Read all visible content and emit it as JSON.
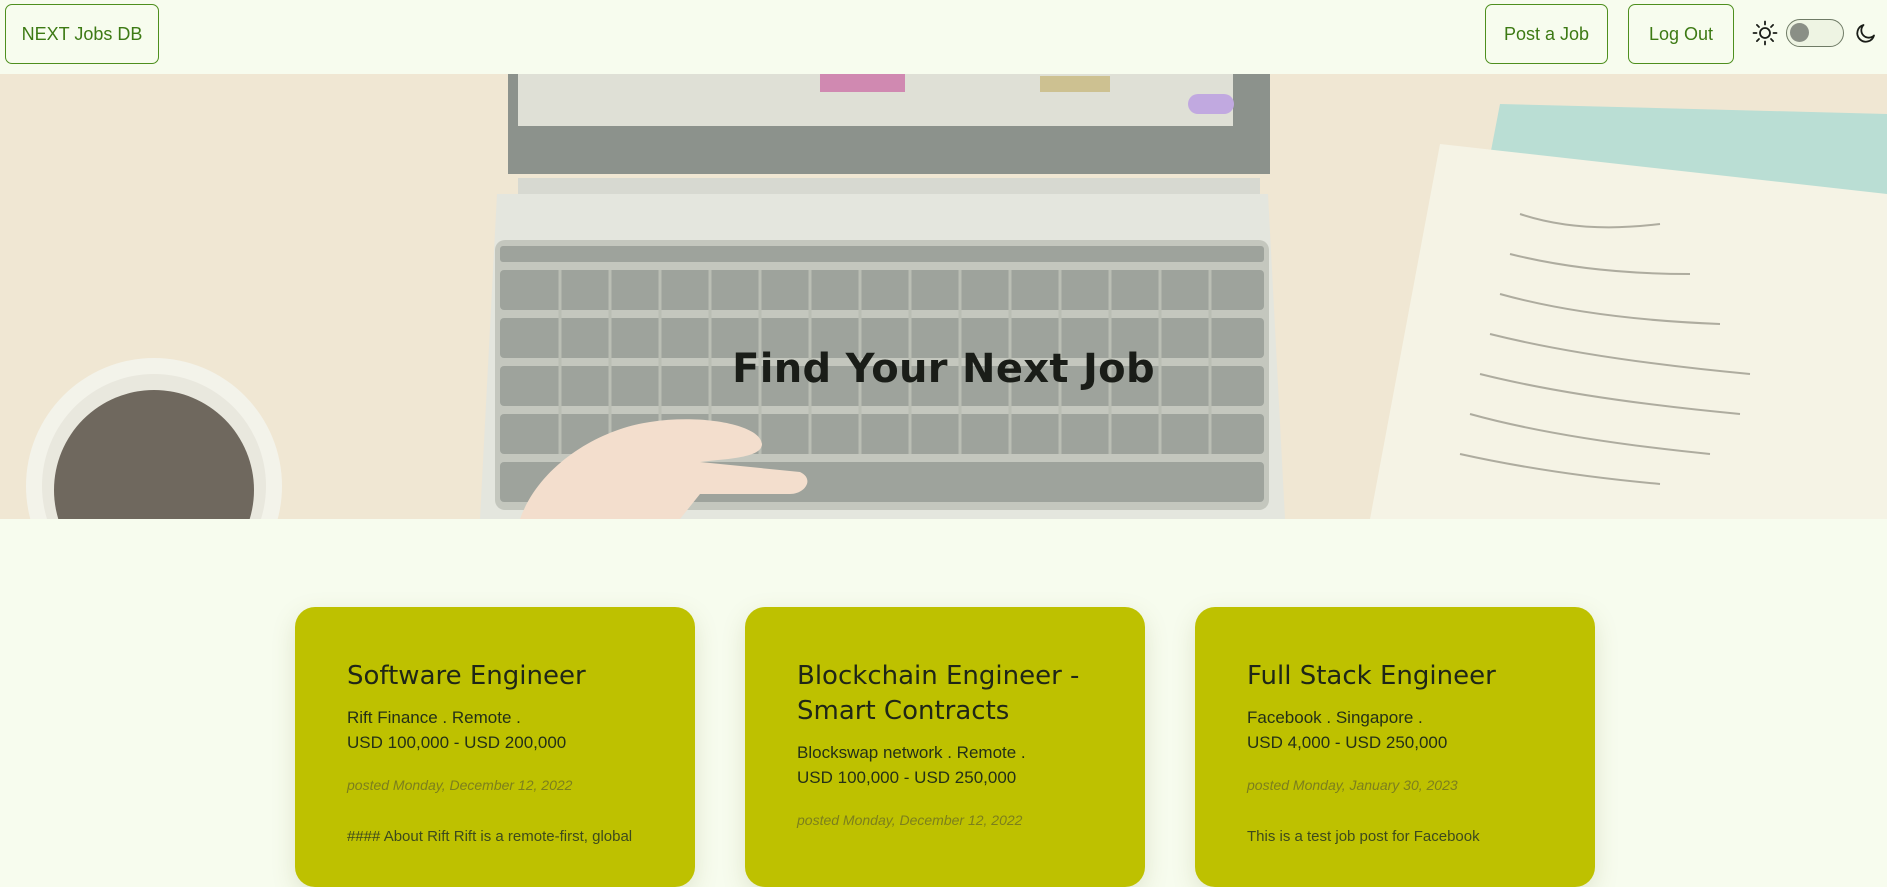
{
  "navbar": {
    "brand": "NEXT Jobs DB",
    "post_job": "Post a Job",
    "logout": "Log Out",
    "theme_toggle": {
      "light_icon": "sun-icon",
      "dark_icon": "moon-icon",
      "state": "light"
    }
  },
  "hero": {
    "title": "Find Your Next Job"
  },
  "colors": {
    "background": "#f7fcee",
    "accent": "#4e8f1e",
    "card": "#bec100"
  },
  "jobs": [
    {
      "title": "Software Engineer",
      "company_location": "Rift Finance . Remote .",
      "salary": "USD 100,000 - USD 200,000",
      "posted": "posted Monday, December 12, 2022",
      "description": "#### About Rift Rift is a remote-first, global"
    },
    {
      "title": "Blockchain Engineer - Smart Contracts",
      "company_location": "Blockswap network . Remote .",
      "salary": "USD 100,000 - USD 250,000",
      "posted": "posted Monday, December 12, 2022",
      "description": ""
    },
    {
      "title": "Full Stack Engineer",
      "company_location": "Facebook . Singapore .",
      "salary": "USD 4,000 - USD 250,000",
      "posted": "posted Monday, January 30, 2023",
      "description": "This is a test job post for Facebook"
    }
  ]
}
